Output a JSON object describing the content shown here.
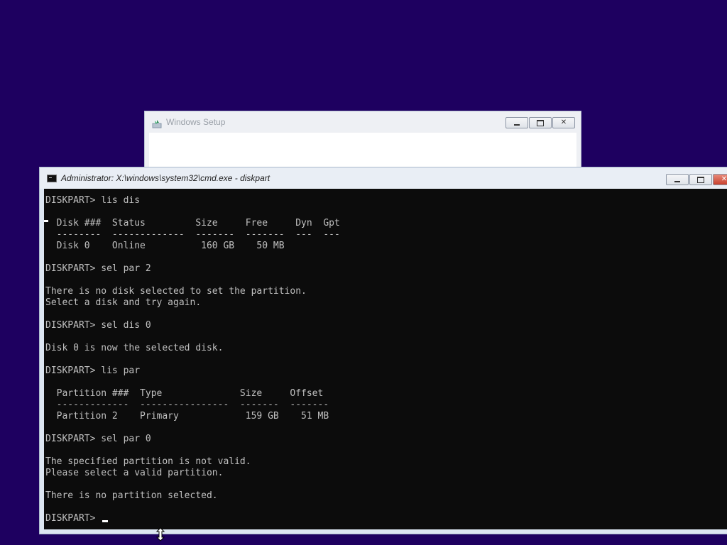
{
  "setup_window": {
    "title": "Windows Setup"
  },
  "cmd_window": {
    "title": "Administrator: X:\\windows\\system32\\cmd.exe - diskpart"
  },
  "console": {
    "lines": [
      {
        "row": 1,
        "text": "DISKPART> lis dis"
      },
      {
        "row": 3,
        "text": "  Disk ###  Status         Size     Free     Dyn  Gpt"
      },
      {
        "row": 4,
        "text": "  --------  -------------  -------  -------  ---  ---"
      },
      {
        "row": 5,
        "text": "  Disk 0    Online          160 GB    50 MB"
      },
      {
        "row": 7,
        "text": "DISKPART> sel par 2"
      },
      {
        "row": 9,
        "text": "There is no disk selected to set the partition."
      },
      {
        "row": 10,
        "text": "Select a disk and try again."
      },
      {
        "row": 12,
        "text": "DISKPART> sel dis 0"
      },
      {
        "row": 14,
        "text": "Disk 0 is now the selected disk."
      },
      {
        "row": 16,
        "text": "DISKPART> lis par"
      },
      {
        "row": 18,
        "text": "  Partition ###  Type              Size     Offset"
      },
      {
        "row": 19,
        "text": "  -------------  ----------------  -------  -------"
      },
      {
        "row": 20,
        "text": "  Partition 2    Primary            159 GB    51 MB"
      },
      {
        "row": 22,
        "text": "DISKPART> sel par 0"
      },
      {
        "row": 24,
        "text": "The specified partition is not valid."
      },
      {
        "row": 25,
        "text": "Please select a valid partition."
      },
      {
        "row": 27,
        "text": "There is no partition selected."
      },
      {
        "row": 29,
        "text": "DISKPART> "
      }
    ]
  },
  "colors": {
    "desktop": "#1e0060",
    "console_bg": "#0c0c0c",
    "console_text": "#c0c0c0"
  }
}
